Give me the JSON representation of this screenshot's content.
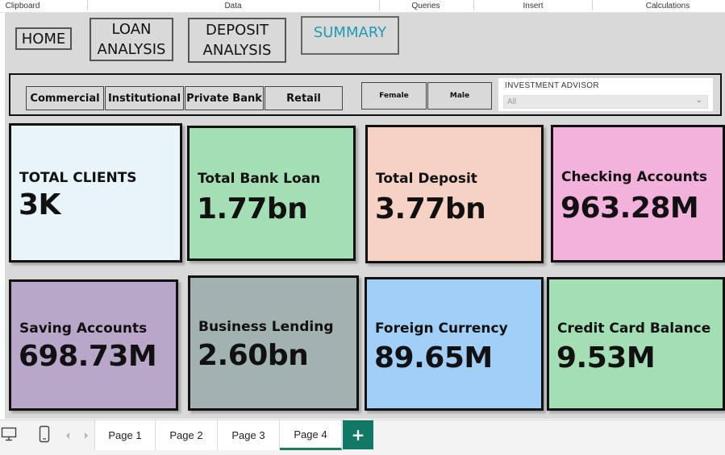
{
  "ribbon": {
    "groups": [
      "Clipboard",
      "Data",
      "Queries",
      "Insert",
      "Calculations"
    ]
  },
  "nav": {
    "home": "HOME",
    "loan": "LOAN ANALYSIS",
    "deposit": "DEPOSIT ANALYSIS",
    "summary": "SUMMARY"
  },
  "slicers": {
    "segments": [
      "Commercial",
      "Institutional",
      "Private Bank",
      "Retail"
    ],
    "genders": [
      "Female",
      "Male"
    ],
    "advisor": {
      "title": "INVESTMENT ADVISOR",
      "value": "All"
    }
  },
  "cards": [
    {
      "label": "TOTAL CLIENTS",
      "value": "3K",
      "color": "#e8f3fa"
    },
    {
      "label": "Total Bank Loan",
      "value": "1.77bn",
      "color": "#a4deb5"
    },
    {
      "label": "Total Deposit",
      "value": "3.77bn",
      "color": "#f6d2c4"
    },
    {
      "label": "Checking Accounts",
      "value": "963.28M",
      "color": "#f3b2dc"
    },
    {
      "label": "Saving Accounts",
      "value": "698.73M",
      "color": "#b8a7c8"
    },
    {
      "label": "Business Lending",
      "value": "2.60bn",
      "color": "#a1b2b0"
    },
    {
      "label": "Foreign Currency",
      "value": "89.65M",
      "color": "#a2cff8"
    },
    {
      "label": "Credit Card Balance",
      "value": "9.53M",
      "color": "#a4deb5"
    }
  ],
  "pages": {
    "tabs": [
      "Page 1",
      "Page 2",
      "Page 3",
      "Page 4"
    ],
    "active": "Page 4",
    "add_label": "+"
  },
  "icons": {
    "desktop": "desktop-icon",
    "mobile": "mobile-icon",
    "prev": "chevron-left-icon",
    "next": "chevron-right-icon"
  }
}
